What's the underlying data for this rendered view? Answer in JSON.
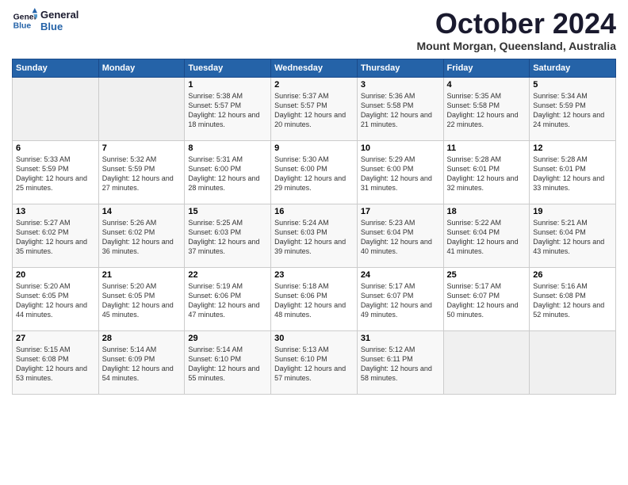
{
  "logo": {
    "line1": "General",
    "line2": "Blue"
  },
  "title": "October 2024",
  "location": "Mount Morgan, Queensland, Australia",
  "days_of_week": [
    "Sunday",
    "Monday",
    "Tuesday",
    "Wednesday",
    "Thursday",
    "Friday",
    "Saturday"
  ],
  "weeks": [
    [
      {
        "day": "",
        "empty": true
      },
      {
        "day": "",
        "empty": true
      },
      {
        "day": "1",
        "sunrise": "Sunrise: 5:38 AM",
        "sunset": "Sunset: 5:57 PM",
        "daylight": "Daylight: 12 hours and 18 minutes."
      },
      {
        "day": "2",
        "sunrise": "Sunrise: 5:37 AM",
        "sunset": "Sunset: 5:57 PM",
        "daylight": "Daylight: 12 hours and 20 minutes."
      },
      {
        "day": "3",
        "sunrise": "Sunrise: 5:36 AM",
        "sunset": "Sunset: 5:58 PM",
        "daylight": "Daylight: 12 hours and 21 minutes."
      },
      {
        "day": "4",
        "sunrise": "Sunrise: 5:35 AM",
        "sunset": "Sunset: 5:58 PM",
        "daylight": "Daylight: 12 hours and 22 minutes."
      },
      {
        "day": "5",
        "sunrise": "Sunrise: 5:34 AM",
        "sunset": "Sunset: 5:59 PM",
        "daylight": "Daylight: 12 hours and 24 minutes."
      }
    ],
    [
      {
        "day": "6",
        "sunrise": "Sunrise: 5:33 AM",
        "sunset": "Sunset: 5:59 PM",
        "daylight": "Daylight: 12 hours and 25 minutes."
      },
      {
        "day": "7",
        "sunrise": "Sunrise: 5:32 AM",
        "sunset": "Sunset: 5:59 PM",
        "daylight": "Daylight: 12 hours and 27 minutes."
      },
      {
        "day": "8",
        "sunrise": "Sunrise: 5:31 AM",
        "sunset": "Sunset: 6:00 PM",
        "daylight": "Daylight: 12 hours and 28 minutes."
      },
      {
        "day": "9",
        "sunrise": "Sunrise: 5:30 AM",
        "sunset": "Sunset: 6:00 PM",
        "daylight": "Daylight: 12 hours and 29 minutes."
      },
      {
        "day": "10",
        "sunrise": "Sunrise: 5:29 AM",
        "sunset": "Sunset: 6:00 PM",
        "daylight": "Daylight: 12 hours and 31 minutes."
      },
      {
        "day": "11",
        "sunrise": "Sunrise: 5:28 AM",
        "sunset": "Sunset: 6:01 PM",
        "daylight": "Daylight: 12 hours and 32 minutes."
      },
      {
        "day": "12",
        "sunrise": "Sunrise: 5:28 AM",
        "sunset": "Sunset: 6:01 PM",
        "daylight": "Daylight: 12 hours and 33 minutes."
      }
    ],
    [
      {
        "day": "13",
        "sunrise": "Sunrise: 5:27 AM",
        "sunset": "Sunset: 6:02 PM",
        "daylight": "Daylight: 12 hours and 35 minutes."
      },
      {
        "day": "14",
        "sunrise": "Sunrise: 5:26 AM",
        "sunset": "Sunset: 6:02 PM",
        "daylight": "Daylight: 12 hours and 36 minutes."
      },
      {
        "day": "15",
        "sunrise": "Sunrise: 5:25 AM",
        "sunset": "Sunset: 6:03 PM",
        "daylight": "Daylight: 12 hours and 37 minutes."
      },
      {
        "day": "16",
        "sunrise": "Sunrise: 5:24 AM",
        "sunset": "Sunset: 6:03 PM",
        "daylight": "Daylight: 12 hours and 39 minutes."
      },
      {
        "day": "17",
        "sunrise": "Sunrise: 5:23 AM",
        "sunset": "Sunset: 6:04 PM",
        "daylight": "Daylight: 12 hours and 40 minutes."
      },
      {
        "day": "18",
        "sunrise": "Sunrise: 5:22 AM",
        "sunset": "Sunset: 6:04 PM",
        "daylight": "Daylight: 12 hours and 41 minutes."
      },
      {
        "day": "19",
        "sunrise": "Sunrise: 5:21 AM",
        "sunset": "Sunset: 6:04 PM",
        "daylight": "Daylight: 12 hours and 43 minutes."
      }
    ],
    [
      {
        "day": "20",
        "sunrise": "Sunrise: 5:20 AM",
        "sunset": "Sunset: 6:05 PM",
        "daylight": "Daylight: 12 hours and 44 minutes."
      },
      {
        "day": "21",
        "sunrise": "Sunrise: 5:20 AM",
        "sunset": "Sunset: 6:05 PM",
        "daylight": "Daylight: 12 hours and 45 minutes."
      },
      {
        "day": "22",
        "sunrise": "Sunrise: 5:19 AM",
        "sunset": "Sunset: 6:06 PM",
        "daylight": "Daylight: 12 hours and 47 minutes."
      },
      {
        "day": "23",
        "sunrise": "Sunrise: 5:18 AM",
        "sunset": "Sunset: 6:06 PM",
        "daylight": "Daylight: 12 hours and 48 minutes."
      },
      {
        "day": "24",
        "sunrise": "Sunrise: 5:17 AM",
        "sunset": "Sunset: 6:07 PM",
        "daylight": "Daylight: 12 hours and 49 minutes."
      },
      {
        "day": "25",
        "sunrise": "Sunrise: 5:17 AM",
        "sunset": "Sunset: 6:07 PM",
        "daylight": "Daylight: 12 hours and 50 minutes."
      },
      {
        "day": "26",
        "sunrise": "Sunrise: 5:16 AM",
        "sunset": "Sunset: 6:08 PM",
        "daylight": "Daylight: 12 hours and 52 minutes."
      }
    ],
    [
      {
        "day": "27",
        "sunrise": "Sunrise: 5:15 AM",
        "sunset": "Sunset: 6:08 PM",
        "daylight": "Daylight: 12 hours and 53 minutes."
      },
      {
        "day": "28",
        "sunrise": "Sunrise: 5:14 AM",
        "sunset": "Sunset: 6:09 PM",
        "daylight": "Daylight: 12 hours and 54 minutes."
      },
      {
        "day": "29",
        "sunrise": "Sunrise: 5:14 AM",
        "sunset": "Sunset: 6:10 PM",
        "daylight": "Daylight: 12 hours and 55 minutes."
      },
      {
        "day": "30",
        "sunrise": "Sunrise: 5:13 AM",
        "sunset": "Sunset: 6:10 PM",
        "daylight": "Daylight: 12 hours and 57 minutes."
      },
      {
        "day": "31",
        "sunrise": "Sunrise: 5:12 AM",
        "sunset": "Sunset: 6:11 PM",
        "daylight": "Daylight: 12 hours and 58 minutes."
      },
      {
        "day": "",
        "empty": true
      },
      {
        "day": "",
        "empty": true
      }
    ]
  ]
}
